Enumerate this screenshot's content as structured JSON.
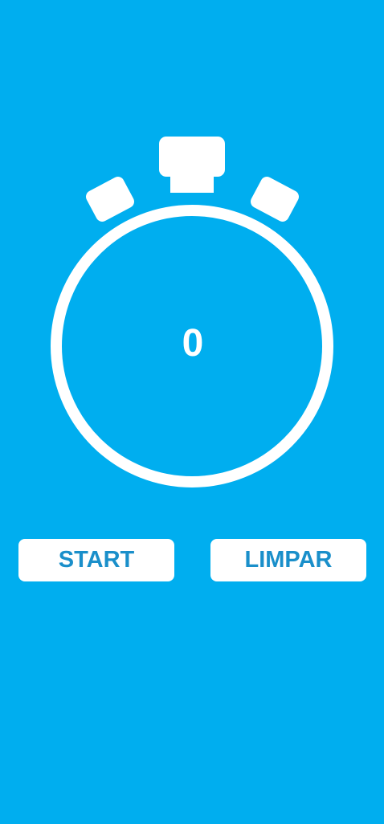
{
  "timer": {
    "value": "0"
  },
  "buttons": {
    "start_label": "START",
    "clear_label": "LIMPAR"
  },
  "colors": {
    "background": "#00AEEF",
    "foreground": "#FFFFFF",
    "button_text": "#1A8FCA"
  },
  "icons": {
    "stopwatch": "stopwatch-icon"
  }
}
